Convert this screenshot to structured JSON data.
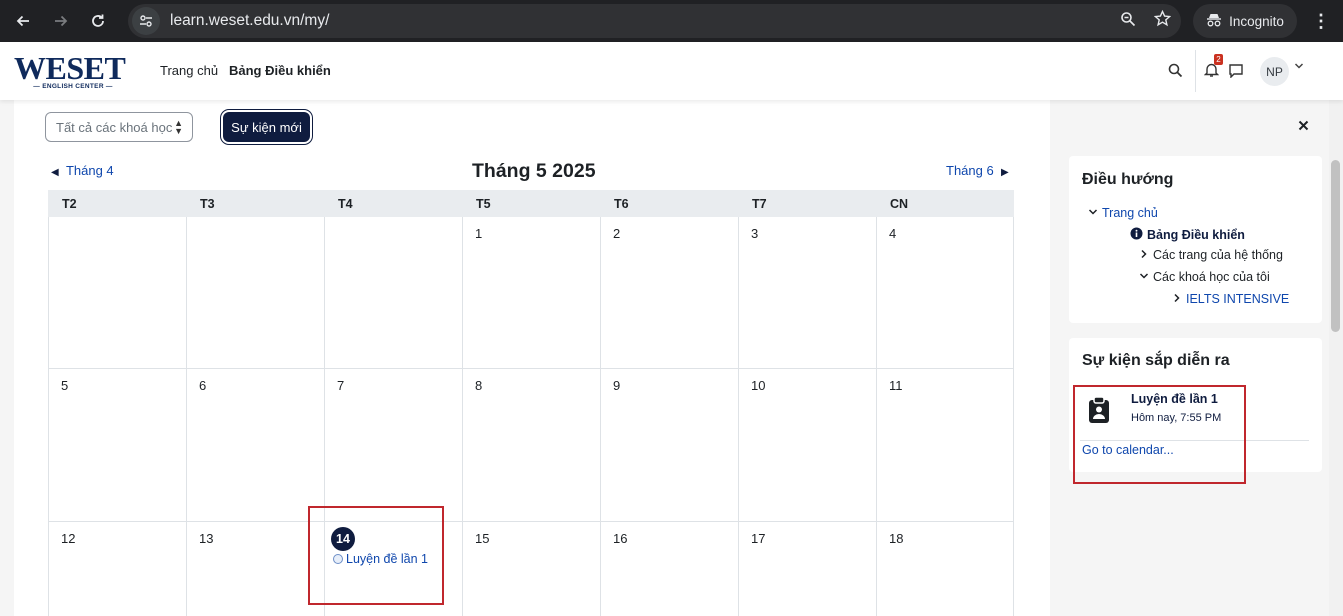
{
  "browser": {
    "url": "learn.weset.edu.vn/my/",
    "incognito_label": "Incognito",
    "back_icon": "arrow-left-icon",
    "forward_icon": "arrow-right-icon",
    "reload_icon": "reload-icon"
  },
  "site": {
    "logo_text": "WESET",
    "logo_subtext": "ENGLISH CENTER",
    "nav": {
      "home": "Trang chủ",
      "dashboard": "Bảng Điều khiển"
    },
    "notification_count": "2",
    "user_initials": "NP"
  },
  "calendar": {
    "course_filter": "Tất cả các khoá học",
    "new_event_label": "Sự kiện mới",
    "prev_month": "Tháng 4",
    "month_title": "Tháng 5 2025",
    "next_month": "Tháng 6",
    "weekdays": [
      "T2",
      "T3",
      "T4",
      "T5",
      "T6",
      "T7",
      "CN"
    ],
    "weeks": [
      [
        "",
        "",
        "",
        "1",
        "2",
        "3",
        "4"
      ],
      [
        "5",
        "6",
        "7",
        "8",
        "9",
        "10",
        "11"
      ],
      [
        "12",
        "13",
        "14",
        "15",
        "16",
        "17",
        "18"
      ]
    ],
    "today": "14",
    "today_event": "Luyện đề lần 1"
  },
  "drawer": {
    "close_icon": "close-icon",
    "navigation": {
      "title": "Điều hướng",
      "home": "Trang chủ",
      "dashboard": "Bảng Điều khiển",
      "site_pages": "Các trang của hệ thống",
      "my_courses": "Các khoá học của tôi",
      "course": "IELTS INTENSIVE"
    },
    "upcoming": {
      "title": "Sự kiện sắp diễn ra",
      "event_name": "Luyện đề lần 1",
      "event_time": "Hôm nay, 7:55 PM",
      "goto_calendar": "Go to calendar..."
    }
  },
  "colors": {
    "brand_navy": "#0f1c3f",
    "link_blue": "#0f47ad",
    "highlight_red": "#c0272d",
    "logo_red": "#c8102e"
  }
}
